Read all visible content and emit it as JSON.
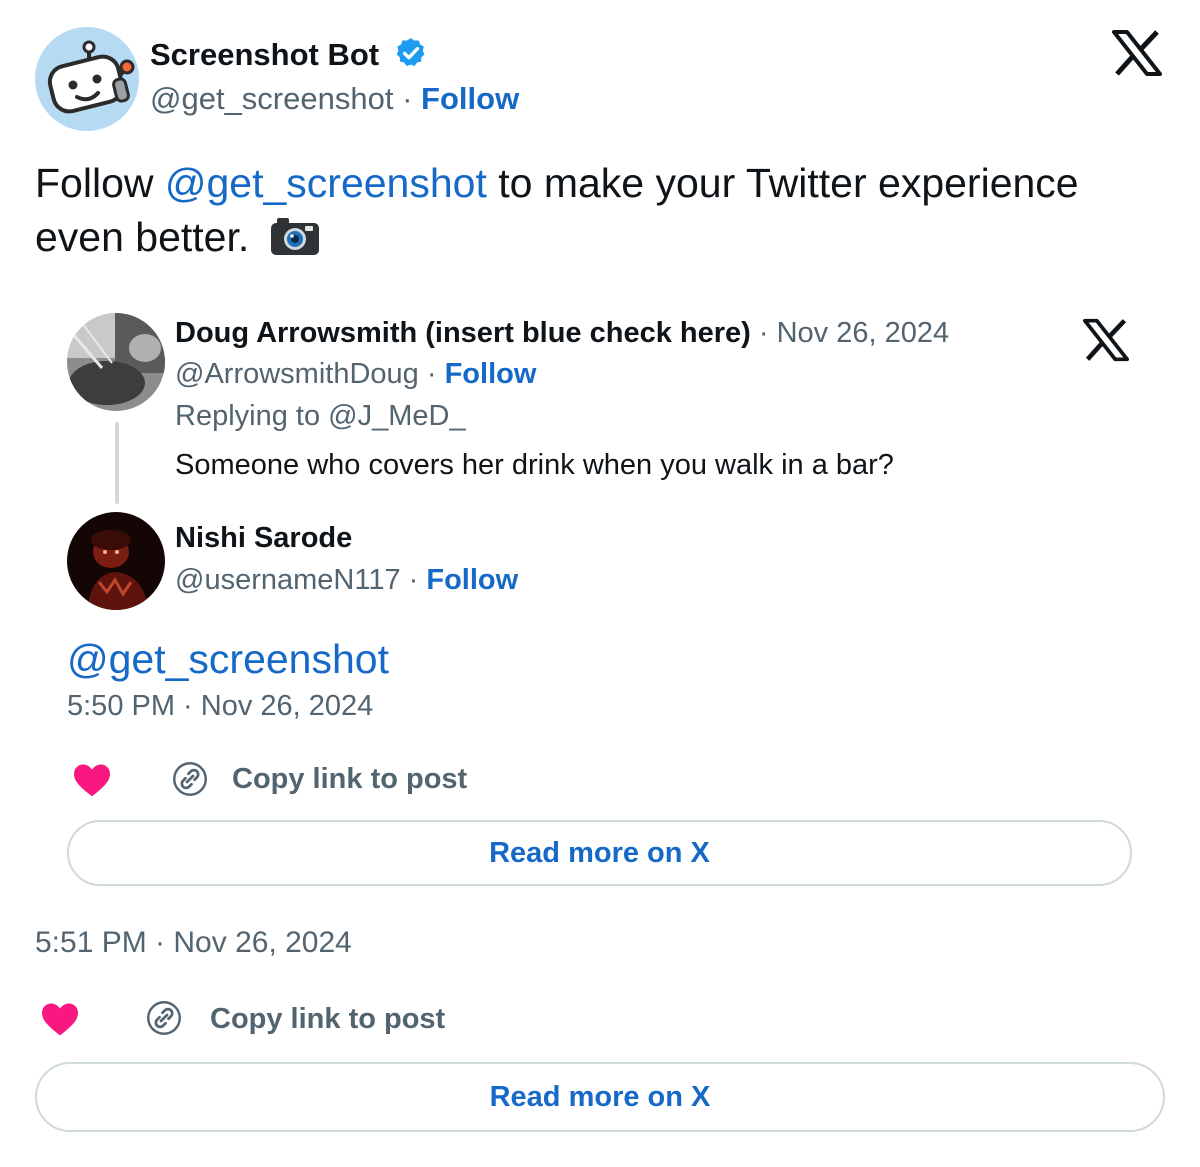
{
  "bot": {
    "name": "Screenshot Bot",
    "handle": "@get_screenshot",
    "separator": "·",
    "follow": "Follow"
  },
  "tweet": {
    "text_before": "Follow ",
    "mention": "@get_screenshot",
    "text_after": " to make your Twitter experience even better.",
    "emoji": "camera-with-flash-icon",
    "time": "5:51 PM · Nov 26, 2024",
    "copy_link": "Copy link to post",
    "read_more": "Read more on X"
  },
  "quote": {
    "doug": {
      "name": "Doug Arrowsmith (insert blue check here)",
      "date": "· Nov 26, 2024",
      "handle": "@ArrowsmithDoug",
      "separator": "·",
      "follow": "Follow",
      "replying": "Replying to @J_MeD_",
      "text": "Someone who covers her drink when you walk in a bar?"
    },
    "nishi": {
      "name": "Nishi Sarode",
      "handle": "@usernameN117",
      "separator": "·",
      "follow": "Follow",
      "text": "@get_screenshot",
      "time": "5:50 PM · Nov 26, 2024",
      "copy_link": "Copy link to post",
      "read_more": "Read more on X"
    }
  },
  "colors": {
    "link_blue": "#1769c8",
    "verified_blue": "#1d9bf0",
    "heart_pink": "#f91880",
    "muted_gray": "#536471",
    "border": "#cfd9de"
  }
}
